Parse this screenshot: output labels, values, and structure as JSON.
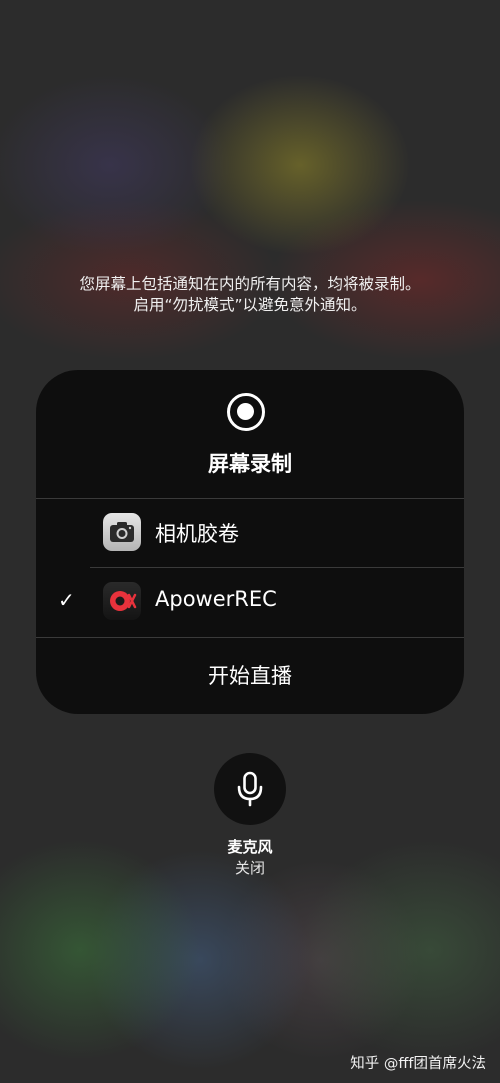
{
  "notice": {
    "line1": "您屏幕上包括通知在内的所有内容，均将被录制。",
    "line2": "启用“勿扰模式”以避免意外通知。"
  },
  "panel": {
    "title": "屏幕录制",
    "options": [
      {
        "label": "相机胶卷",
        "icon": "camera-app-icon",
        "selected": false
      },
      {
        "label": "ApowerREC",
        "icon": "apowerrec-app-icon",
        "selected": true
      }
    ],
    "check_glyph": "✓",
    "start_broadcast_label": "开始直播"
  },
  "microphone": {
    "label": "麦克风",
    "status": "关闭",
    "icon": "microphone-icon"
  },
  "watermark": "知乎 @fff团首席火法",
  "colors": {
    "panel_background": "#0e0e0e",
    "apowerrec_accent": "#e8323c"
  }
}
